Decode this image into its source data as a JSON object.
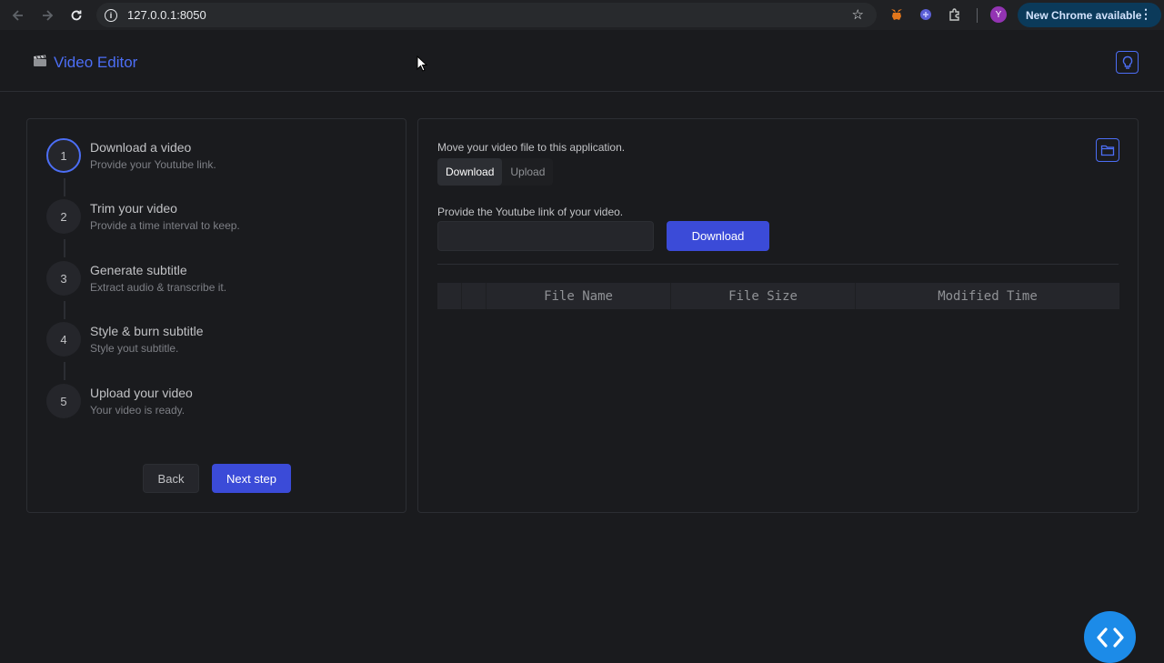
{
  "browser": {
    "url": "127.0.0.1:8050",
    "update_label": "New Chrome available",
    "avatar_letter": "Y"
  },
  "header": {
    "title": "Video Editor"
  },
  "stepper": {
    "steps": [
      {
        "number": "1",
        "title": "Download a video",
        "description": "Provide your Youtube link."
      },
      {
        "number": "2",
        "title": "Trim your video",
        "description": "Provide a time interval to keep."
      },
      {
        "number": "3",
        "title": "Generate subtitle",
        "description": "Extract audio & transcribe it."
      },
      {
        "number": "4",
        "title": "Style & burn subtitle",
        "description": "Style yout subtitle."
      },
      {
        "number": "5",
        "title": "Upload your video",
        "description": "Your video is ready."
      }
    ],
    "back_label": "Back",
    "next_label": "Next step"
  },
  "main": {
    "move_label": "Move your video file to this application.",
    "tabs": [
      {
        "label": "Download",
        "active": true
      },
      {
        "label": "Upload",
        "active": false
      }
    ],
    "youtube_label": "Provide the Youtube link of your video.",
    "youtube_value": "",
    "download_label": "Download",
    "table": {
      "columns": [
        "",
        "",
        "File Name",
        "File Size",
        "Modified Time"
      ]
    }
  },
  "colors": {
    "accent": "#4c6ef5",
    "button": "#3b4bd8",
    "background": "#1a1b1e"
  }
}
